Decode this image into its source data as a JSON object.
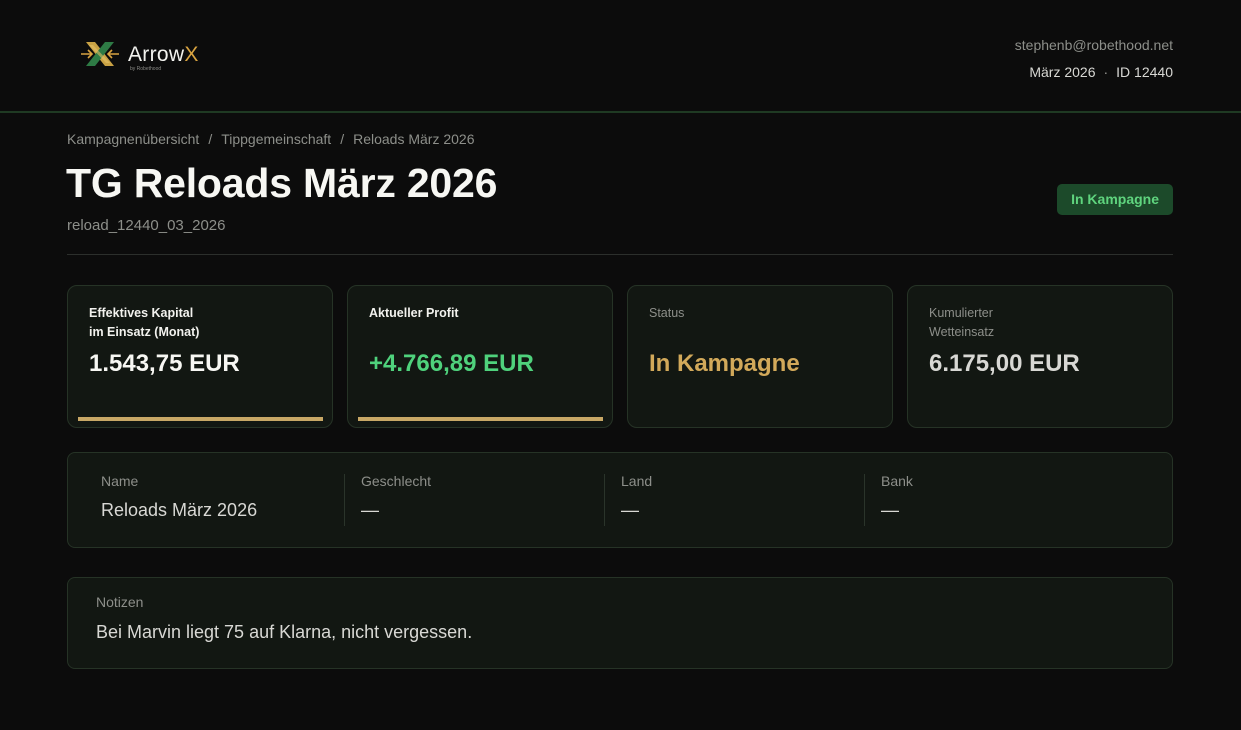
{
  "header": {
    "brand_name": "Arrow",
    "brand_accent": "X",
    "brand_sub": "by Robethood",
    "logo_icon": "arrowx-logo-icon",
    "user_email": "stephenb@robethood.net",
    "period": "März 2026",
    "separator": "·",
    "user_id": "ID 12440"
  },
  "breadcrumb": {
    "items": [
      "Kampagnenübersicht",
      "Tippgemeinschaft",
      "Reloads März 2026"
    ],
    "separator": "/"
  },
  "page": {
    "title": "TG Reloads März 2026",
    "subtitle": "reload_12440_03_2026",
    "status_badge": "In Kampagne"
  },
  "cards": [
    {
      "label_line1": "Effektives Kapital",
      "label_line2": "im Einsatz (Monat)",
      "value": "1.543,75 EUR"
    },
    {
      "label_line1": "Aktueller Profit",
      "label_line2": "",
      "value": "+4.766,89 EUR"
    },
    {
      "label_line1": "Status",
      "label_line2": "",
      "value": "In Kampagne"
    },
    {
      "label_line1": "Kumulierter",
      "label_line2": "Wetteinsatz",
      "value": "6.175,00 EUR"
    }
  ],
  "info": [
    {
      "label": "Name",
      "value": "Reloads März 2026"
    },
    {
      "label": "Geschlecht",
      "value": "—"
    },
    {
      "label": "Land",
      "value": "—"
    },
    {
      "label": "Bank",
      "value": "—"
    }
  ],
  "notes": {
    "label": "Notizen",
    "text": "Bei Marvin liegt 75 auf Klarna, nicht vergessen."
  },
  "colors": {
    "background": "#0c0c0c",
    "accent_gold": "#d9a441",
    "profit_green": "#4fd27c",
    "status_gold": "#d2a95a",
    "badge_bg": "#1c4a2a",
    "badge_text": "#5fd47e"
  }
}
